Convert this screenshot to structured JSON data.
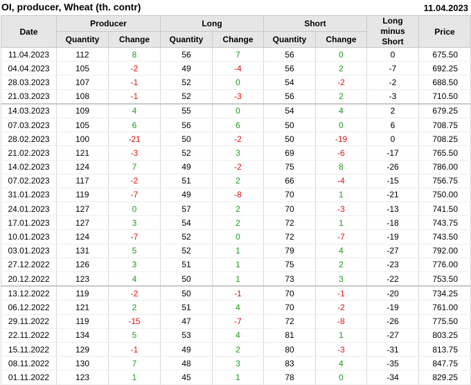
{
  "header": {
    "title": "OI, producer, Wheat (th. contr)",
    "date": "11.04.2023"
  },
  "columns": {
    "date": "Date",
    "producer": "Producer",
    "long": "Long",
    "short": "Short",
    "long_minus_short": "Long minus Short",
    "price": "Price",
    "quantity": "Quantity",
    "change": "Change"
  },
  "rows": [
    {
      "date": "11.04.2023",
      "pq": "112",
      "pc": "8",
      "lq": "56",
      "lc": "7",
      "sq": "56",
      "sc": "0",
      "lms": "0",
      "price": "675.50"
    },
    {
      "date": "04.04.2023",
      "pq": "105",
      "pc": "-2",
      "lq": "49",
      "lc": "-4",
      "sq": "56",
      "sc": "2",
      "lms": "-7",
      "price": "692.25"
    },
    {
      "date": "28.03.2023",
      "pq": "107",
      "pc": "-1",
      "lq": "52",
      "lc": "0",
      "sq": "54",
      "sc": "-2",
      "lms": "-2",
      "price": "688.50"
    },
    {
      "date": "21.03.2023",
      "pq": "108",
      "pc": "-1",
      "lq": "52",
      "lc": "-3",
      "sq": "56",
      "sc": "2",
      "lms": "-3",
      "price": "710.50"
    },
    {
      "date": "14.03.2023",
      "pq": "109",
      "pc": "4",
      "lq": "55",
      "lc": "0",
      "sq": "54",
      "sc": "4",
      "lms": "2",
      "price": "679.25"
    },
    {
      "date": "07.03.2023",
      "pq": "105",
      "pc": "6",
      "lq": "56",
      "lc": "6",
      "sq": "50",
      "sc": "0",
      "lms": "6",
      "price": "708.75"
    },
    {
      "date": "28.02.2023",
      "pq": "100",
      "pc": "-21",
      "lq": "50",
      "lc": "-2",
      "sq": "50",
      "sc": "-19",
      "lms": "0",
      "price": "708.25"
    },
    {
      "date": "21.02.2023",
      "pq": "121",
      "pc": "-3",
      "lq": "52",
      "lc": "3",
      "sq": "69",
      "sc": "-6",
      "lms": "-17",
      "price": "765.50"
    },
    {
      "date": "14.02.2023",
      "pq": "124",
      "pc": "7",
      "lq": "49",
      "lc": "-2",
      "sq": "75",
      "sc": "8",
      "lms": "-26",
      "price": "786.00"
    },
    {
      "date": "07.02.2023",
      "pq": "117",
      "pc": "-2",
      "lq": "51",
      "lc": "2",
      "sq": "66",
      "sc": "-4",
      "lms": "-15",
      "price": "756.75"
    },
    {
      "date": "31.01.2023",
      "pq": "119",
      "pc": "-7",
      "lq": "49",
      "lc": "-8",
      "sq": "70",
      "sc": "1",
      "lms": "-21",
      "price": "750.00"
    },
    {
      "date": "24.01.2023",
      "pq": "127",
      "pc": "0",
      "lq": "57",
      "lc": "2",
      "sq": "70",
      "sc": "-3",
      "lms": "-13",
      "price": "741.50"
    },
    {
      "date": "17.01.2023",
      "pq": "127",
      "pc": "3",
      "lq": "54",
      "lc": "2",
      "sq": "72",
      "sc": "1",
      "lms": "-18",
      "price": "743.75"
    },
    {
      "date": "10.01.2023",
      "pq": "124",
      "pc": "-7",
      "lq": "52",
      "lc": "0",
      "sq": "72",
      "sc": "-7",
      "lms": "-19",
      "price": "743.50"
    },
    {
      "date": "03.01.2023",
      "pq": "131",
      "pc": "5",
      "lq": "52",
      "lc": "1",
      "sq": "79",
      "sc": "4",
      "lms": "-27",
      "price": "792.00"
    },
    {
      "date": "27.12.2022",
      "pq": "126",
      "pc": "3",
      "lq": "51",
      "lc": "1",
      "sq": "75",
      "sc": "2",
      "lms": "-23",
      "price": "776.00"
    },
    {
      "date": "20.12.2022",
      "pq": "123",
      "pc": "4",
      "lq": "50",
      "lc": "1",
      "sq": "73",
      "sc": "3",
      "lms": "-22",
      "price": "753.50"
    },
    {
      "date": "13.12.2022",
      "pq": "119",
      "pc": "-2",
      "lq": "50",
      "lc": "-1",
      "sq": "70",
      "sc": "-1",
      "lms": "-20",
      "price": "734.25"
    },
    {
      "date": "06.12.2022",
      "pq": "121",
      "pc": "2",
      "lq": "51",
      "lc": "4",
      "sq": "70",
      "sc": "-2",
      "lms": "-19",
      "price": "761.00"
    },
    {
      "date": "29.11.2022",
      "pq": "119",
      "pc": "-15",
      "lq": "47",
      "lc": "-7",
      "sq": "72",
      "sc": "-8",
      "lms": "-26",
      "price": "775.50"
    },
    {
      "date": "22.11.2022",
      "pq": "134",
      "pc": "5",
      "lq": "53",
      "lc": "4",
      "sq": "81",
      "sc": "1",
      "lms": "-27",
      "price": "803.25"
    },
    {
      "date": "15.11.2022",
      "pq": "129",
      "pc": "-1",
      "lq": "49",
      "lc": "2",
      "sq": "80",
      "sc": "-3",
      "lms": "-31",
      "price": "813.75"
    },
    {
      "date": "08.11.2022",
      "pq": "130",
      "pc": "7",
      "lq": "48",
      "lc": "3",
      "sq": "83",
      "sc": "4",
      "lms": "-35",
      "price": "847.75"
    },
    {
      "date": "01.11.2022",
      "pq": "123",
      "pc": "1",
      "lq": "45",
      "lc": "1",
      "sq": "78",
      "sc": "0",
      "lms": "-34",
      "price": "829.25"
    }
  ],
  "month_separator_before": [
    4,
    17
  ],
  "colors": {
    "positive": "#1a9a1a",
    "negative": "#e01010",
    "header_bg": "#e6e6e6"
  }
}
